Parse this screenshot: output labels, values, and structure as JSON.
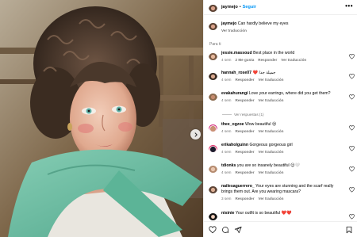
{
  "post": {
    "username": "jaymejo",
    "separator": "•",
    "follow_label": "Seguir",
    "more_label": "•••",
    "caption": "Can hardly believe my eyes",
    "see_translation": "Ver traducción",
    "for_you_label": "Para ti"
  },
  "comments": [
    {
      "user": "jessie.massoud",
      "text": "Best place in the world",
      "time": "4 sem",
      "likes": "2 Me gusta",
      "reply": "Responder",
      "translate": "Ver traducción"
    },
    {
      "user": "hannah_rose07",
      "text": "❤️ جميلة جدا",
      "time": "4 sem",
      "reply": "Responder",
      "translate": "Ver traducción"
    },
    {
      "user": "evakahurangi",
      "text": "Love your earrings, where did you get them?",
      "time": "4 sem",
      "reply": "Responder",
      "translate": "Ver traducción"
    },
    {
      "user": "thee_ogzoe",
      "text": "Wow beautiful 😍",
      "time": "4 sem",
      "reply": "Responder",
      "translate": "Ver traducción"
    },
    {
      "user": "erikaholguinn",
      "text": "Gorgeous gorgeous girl",
      "time": "4 sem",
      "reply": "Responder",
      "translate": "Ver traducción"
    },
    {
      "user": "tdionks",
      "text": "you are so insanely beautiful 😊🤍",
      "time": "4 sem",
      "reply": "Responder",
      "translate": "Ver traducción"
    },
    {
      "user": "nailesaguerrero_",
      "text": "Your eyes are stunning and the scarf really brings them out. Are you wearing mascara?",
      "time": "3 sem",
      "reply": "Responder",
      "translate": "Ver traducción"
    },
    {
      "user": "nisinie",
      "text": "Your outfit is so beautiful ❤️❤️"
    }
  ],
  "replies": {
    "label": "Ver respuestas (1)"
  },
  "colors": {
    "accent": "#0095f6",
    "muted": "#737373",
    "heart": "#ed4956"
  },
  "icons": [
    "heart-icon",
    "comment-icon",
    "share-icon",
    "bookmark-icon",
    "chevron-right-icon",
    "more-icon"
  ]
}
